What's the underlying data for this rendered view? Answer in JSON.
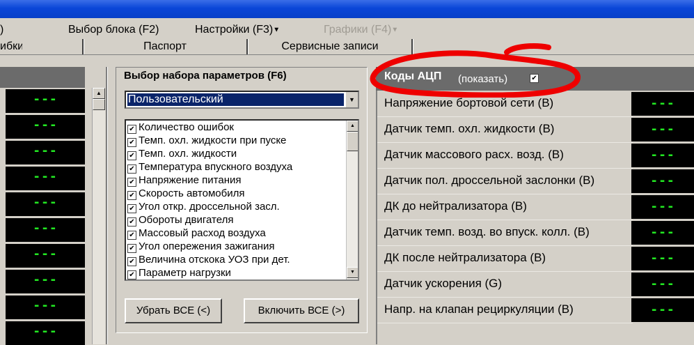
{
  "menu": {
    "items": [
      {
        "label": ")",
        "disabled": false
      },
      {
        "label": "Выбор блока (F2)",
        "disabled": false
      },
      {
        "label": "Настройки (F3)",
        "disabled": false,
        "dropdown": true
      },
      {
        "label": "Графики (F4)",
        "disabled": true,
        "dropdown": true
      }
    ]
  },
  "tabs": [
    "ибки",
    "Паспорт",
    "Сервисные записи"
  ],
  "left_values": [
    "---",
    "---",
    "---",
    "---",
    "---",
    "---",
    "---",
    "---",
    "---",
    "---"
  ],
  "param_set": {
    "title": "Выбор набора параметров (F6)",
    "selected": "Пользовательский",
    "items": [
      "Количество ошибок",
      "Темп. охл. жидкости при пуске",
      "Темп. охл. жидкости",
      "Температура впускного воздуха",
      "Напряжение питания",
      "Скорость автомобиля",
      "Угол откр. дроссельной засл.",
      "Обороты двигателя",
      "Массовый расход воздуха",
      "Угол опережения зажигания",
      "Величина отскока УОЗ при дет.",
      "Параметр нагрузки"
    ],
    "remove_all": "Убрать ВСЕ (<)",
    "enable_all": "Включить ВСЕ (>)"
  },
  "adc": {
    "title": "Коды АЦП",
    "show_label": "(показать)",
    "show_checked": true,
    "rows": [
      "Напряжение бортовой сети (В)",
      "Датчик темп. охл. жидкости (В)",
      "Датчик массового расх. возд. (В)",
      "Датчик пол. дроссельной заслонки (В)",
      "ДК до нейтрализатора (В)",
      "Датчик темп. возд. во впуск. колл. (В)",
      "ДК после нейтрализатора (В)",
      "Датчик ускорения (G)",
      "Напр. на клапан рециркуляции (В)"
    ],
    "values": [
      "---",
      "---",
      "---",
      "---",
      "---",
      "---",
      "---",
      "---",
      "---"
    ]
  },
  "colors": {
    "accent_titlebar": "#0a46d8",
    "value_green": "#22e722",
    "annotation_red": "#ee0000"
  },
  "icons": {
    "checkbox": "check-icon",
    "dropdown": "chevron-down-icon"
  }
}
